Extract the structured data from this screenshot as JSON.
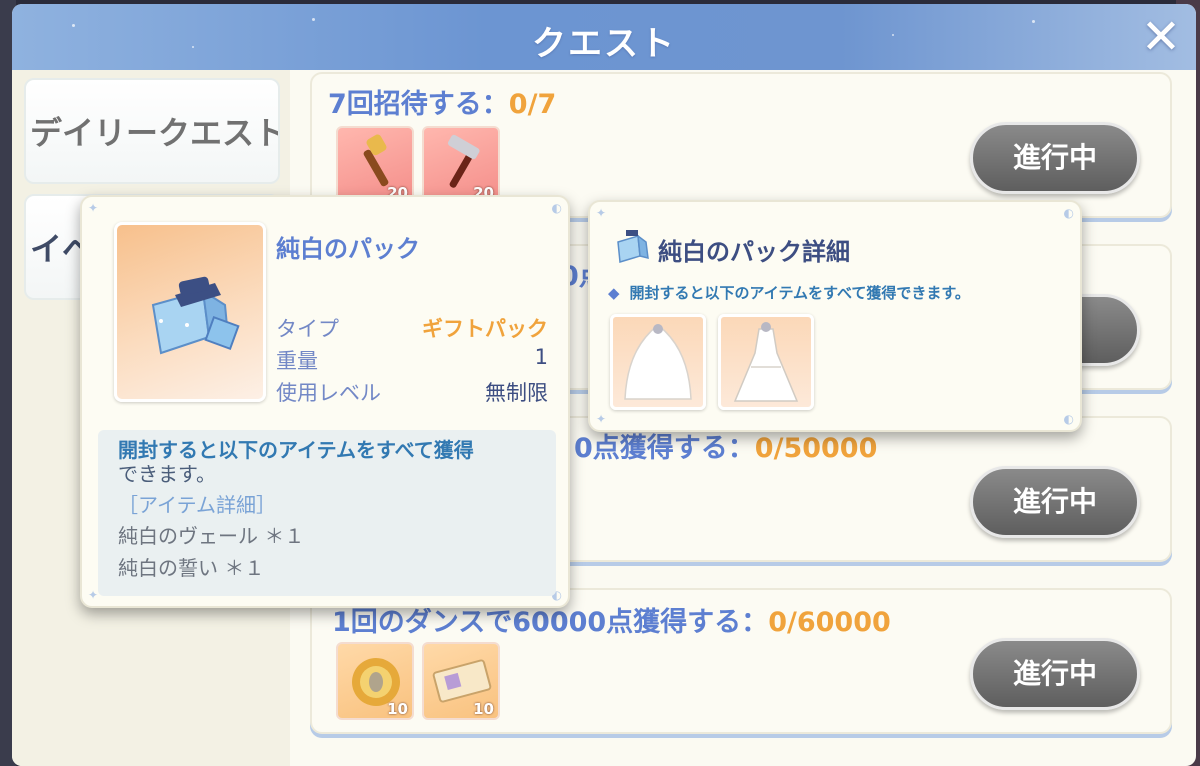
{
  "header": {
    "title": "クエスト",
    "close_label": "✕"
  },
  "sidebar": {
    "tabs": [
      {
        "label": "デイリークエスト"
      },
      {
        "label": "イベ"
      }
    ]
  },
  "quests": [
    {
      "title": "7回招待する：",
      "progress": "0/7",
      "button": "進行中",
      "rewards": [
        {
          "icon": "wrench-icon",
          "count": "20"
        },
        {
          "icon": "hammer-icon",
          "count": "20"
        }
      ]
    },
    {
      "title": "",
      "progress": "0点",
      "button": "中",
      "rewards": []
    },
    {
      "title": "0点獲得する：",
      "progress": "0/50000",
      "button": "進行中",
      "rewards": []
    },
    {
      "title": "1回のダンスで60000点獲得する：",
      "progress": "0/60000",
      "button": "進行中",
      "rewards": [
        {
          "icon": "gold-coin-icon",
          "count": "10"
        },
        {
          "icon": "ticket-icon",
          "count": "10"
        }
      ]
    }
  ],
  "item_popup": {
    "name": "純白のパック",
    "props": [
      {
        "label": "タイプ",
        "value": "ギフトパック"
      },
      {
        "label": "重量",
        "value": "1"
      },
      {
        "label": "使用レベル",
        "value": "無制限"
      }
    ],
    "desc_main": "開封すると以下のアイテムをすべて獲得",
    "desc_main_cont": "できます。",
    "detail_label": "［アイテム詳細］",
    "contents": [
      "純白のヴェール ＊１",
      "純白の誓い ＊１"
    ]
  },
  "detail_popup": {
    "title": "純白のパック詳細",
    "desc": "開封すると以下のアイテムをすべて獲得できます。",
    "items": [
      {
        "icon": "veil-icon"
      },
      {
        "icon": "wedding-dress-icon"
      }
    ]
  },
  "colors": {
    "accent_blue": "#5d7fd1",
    "orange": "#f0a33c",
    "title_bar": "#6c95d2"
  }
}
